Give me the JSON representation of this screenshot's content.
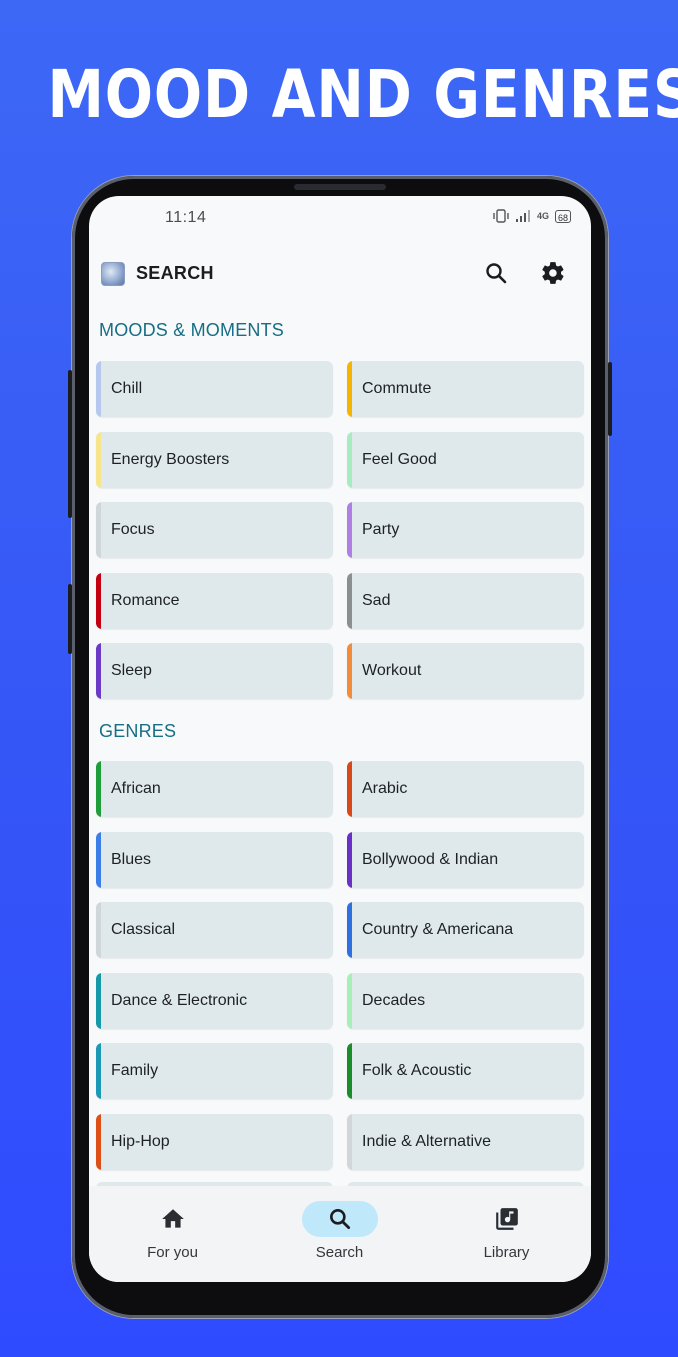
{
  "headline": "MOOD AND GENRES",
  "status_bar": {
    "time": "11:14",
    "battery": "68",
    "network": "4G"
  },
  "app_bar": {
    "title": "SEARCH",
    "search_icon": "search-icon",
    "settings_icon": "gear-icon"
  },
  "moods": {
    "title": "MOODS & MOMENTS",
    "items": [
      {
        "label": "Chill",
        "color": "#b7c8ef"
      },
      {
        "label": "Commute",
        "color": "#f4b400"
      },
      {
        "label": "Energy Boosters",
        "color": "#f6e58d"
      },
      {
        "label": "Feel Good",
        "color": "#a6ecc0"
      },
      {
        "label": "Focus",
        "color": "#d0d6da"
      },
      {
        "label": "Party",
        "color": "#b07fe6"
      },
      {
        "label": "Romance",
        "color": "#c30012"
      },
      {
        "label": "Sad",
        "color": "#8c8f92"
      },
      {
        "label": "Sleep",
        "color": "#6c3bc5"
      },
      {
        "label": "Workout",
        "color": "#f28b3a"
      }
    ]
  },
  "genres": {
    "title": "GENRES",
    "items": [
      {
        "label": "African",
        "color": "#1f9d3a"
      },
      {
        "label": "Arabic",
        "color": "#d9481b"
      },
      {
        "label": "Blues",
        "color": "#3c7ee8"
      },
      {
        "label": "Bollywood & Indian",
        "color": "#6a2fc6"
      },
      {
        "label": "Classical",
        "color": "#d0d6da"
      },
      {
        "label": "Country & Americana",
        "color": "#2f6fe0"
      },
      {
        "label": "Dance & Electronic",
        "color": "#1598a8"
      },
      {
        "label": "Decades",
        "color": "#a6f0b8"
      },
      {
        "label": "Family",
        "color": "#1a98b6"
      },
      {
        "label": "Folk & Acoustic",
        "color": "#1a8c2a"
      },
      {
        "label": "Hip-Hop",
        "color": "#dc4f16"
      },
      {
        "label": "Indie & Alternative",
        "color": "#d0d6da"
      }
    ]
  },
  "bottom_nav": {
    "items": [
      {
        "label": "For you",
        "icon": "home-icon",
        "active": false
      },
      {
        "label": "Search",
        "icon": "search-icon",
        "active": true
      },
      {
        "label": "Library",
        "icon": "library-music-icon",
        "active": false
      }
    ]
  }
}
